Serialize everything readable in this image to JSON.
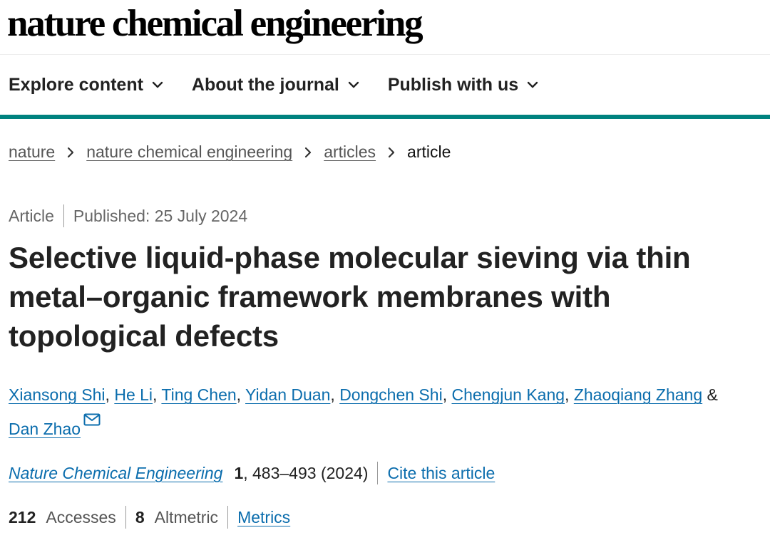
{
  "header": {
    "logo_text": "nature chemical engineering"
  },
  "nav": {
    "items": [
      {
        "label": "Explore content",
        "icon": "chevron-down-icon"
      },
      {
        "label": "About the journal",
        "icon": "chevron-down-icon"
      },
      {
        "label": "Publish with us",
        "icon": "chevron-down-icon"
      }
    ],
    "accent_color": "#00827f"
  },
  "breadcrumb": {
    "items": [
      "nature",
      "nature chemical engineering",
      "articles"
    ],
    "current": "article",
    "separator_icon": "chevron-right-icon"
  },
  "article": {
    "type": "Article",
    "published": "Published: 25 July 2024",
    "title": "Selective liquid-phase molecular sieving via thin metal–organic framework membranes with topological defects"
  },
  "authors": {
    "list": [
      "Xiansong Shi",
      "He Li",
      "Ting Chen",
      "Yidan Duan",
      "Dongchen Shi",
      "Chengjun Kang",
      "Zhaoqiang Zhang"
    ],
    "conjunction": "&",
    "last": "Dan Zhao",
    "contact_icon": "mail-icon"
  },
  "citation": {
    "journal": "Nature Chemical Engineering",
    "volume": "1",
    "pages_year": ", 483–493 (2024)",
    "cite_label": "Cite this article"
  },
  "metrics": {
    "accesses_count": "212",
    "accesses_label": "Accesses",
    "altmetric_count": "8",
    "altmetric_label": "Altmetric",
    "metrics_link": "Metrics"
  },
  "colors": {
    "link": "#0b6dad",
    "text": "#222222",
    "muted": "#666666"
  }
}
